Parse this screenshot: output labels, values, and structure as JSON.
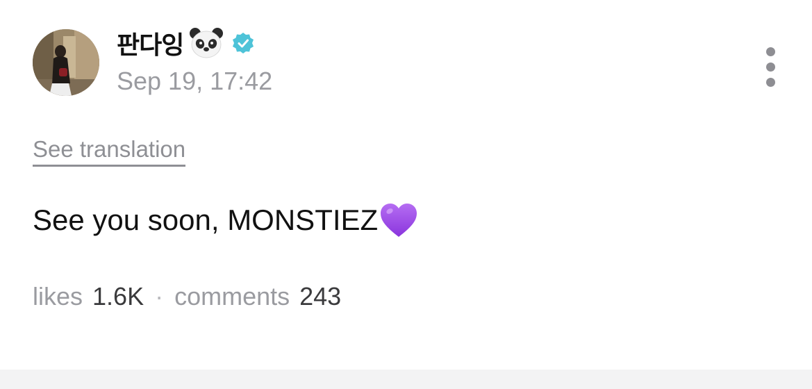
{
  "post": {
    "author": {
      "name": "판다잉",
      "emoji_icon": "panda-face-icon",
      "verified_icon": "verified-badge-icon",
      "avatar_icon": "profile-photo"
    },
    "timestamp": "Sep 19, 17:42",
    "more_icon": "vertical-ellipsis-icon",
    "translation_link": "See translation",
    "body_text": "See you soon, MONSTIEZ",
    "body_emoji": "purple-heart-icon",
    "stats": {
      "likes_label": "likes",
      "likes_value": "1.6K",
      "separator": "·",
      "comments_label": "comments",
      "comments_value": "243"
    }
  },
  "colors": {
    "verified": "#4ec3d8",
    "heart": "#9b4be8",
    "muted_text": "#9a9ba0",
    "primary_text": "#111111",
    "bottom_band": "#f3f3f4"
  }
}
